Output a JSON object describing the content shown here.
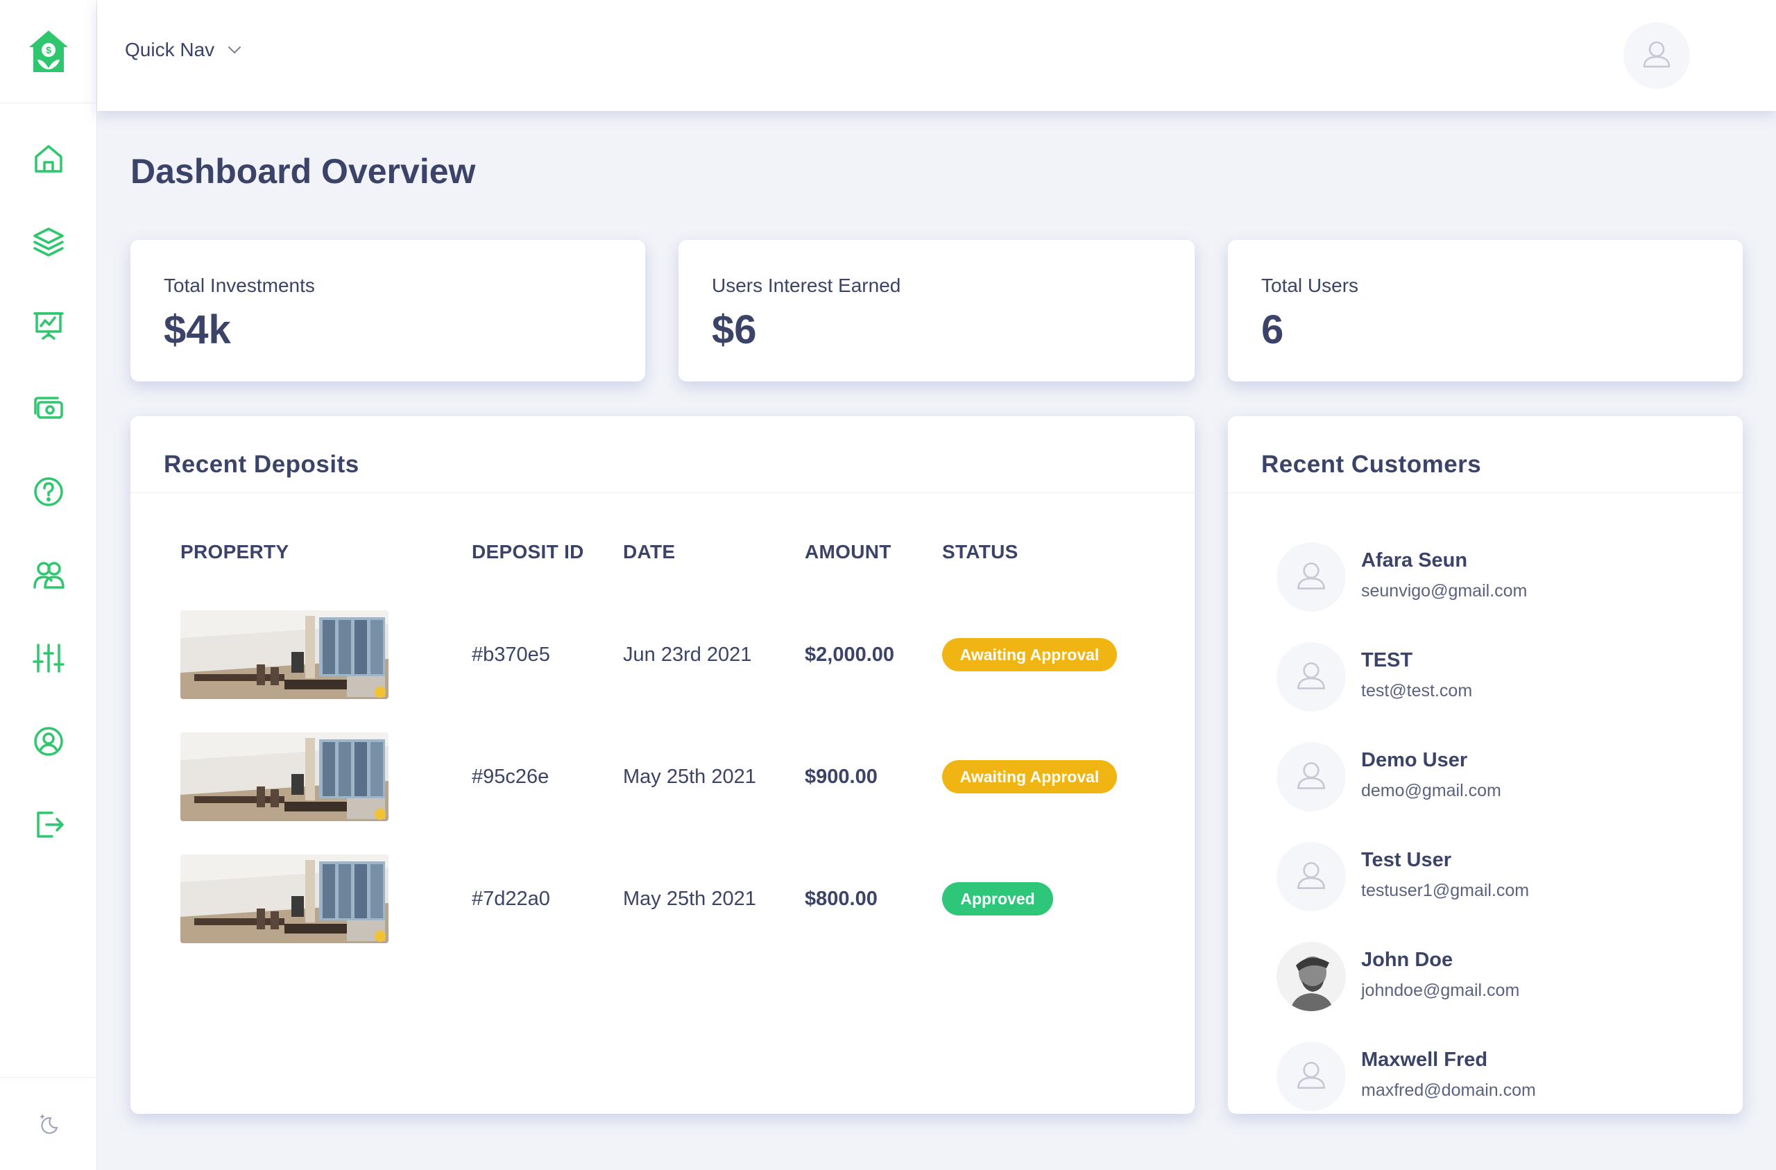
{
  "colors": {
    "accent": "#2ec76e",
    "text": "#3b4468",
    "awaiting": "#f0b413",
    "approved": "#2ec77a",
    "background": "#f1f3f8"
  },
  "sidebar": {
    "logo_icon": "house-money-icon",
    "items": [
      {
        "icon": "home-icon"
      },
      {
        "icon": "layers-icon"
      },
      {
        "icon": "presentation-chart-icon"
      },
      {
        "icon": "cash-icon"
      },
      {
        "icon": "help-circle-icon"
      },
      {
        "icon": "users-icon"
      },
      {
        "icon": "sliders-icon"
      },
      {
        "icon": "user-circle-icon"
      },
      {
        "icon": "logout-icon"
      }
    ],
    "footer_icon": "moon-icon"
  },
  "header": {
    "quick_nav_label": "Quick Nav"
  },
  "page": {
    "title": "Dashboard Overview"
  },
  "stats": [
    {
      "label": "Total Investments",
      "value": "$4k"
    },
    {
      "label": "Users Interest Earned",
      "value": "$6"
    },
    {
      "label": "Total Users",
      "value": "6"
    }
  ],
  "deposits": {
    "title": "Recent Deposits",
    "columns": [
      "PROPERTY",
      "DEPOSIT ID",
      "DATE",
      "AMOUNT",
      "STATUS"
    ],
    "rows": [
      {
        "id": "#b370e5",
        "date": "Jun 23rd 2021",
        "amount": "$2,000.00",
        "status": "Awaiting Approval"
      },
      {
        "id": "#95c26e",
        "date": "May 25th 2021",
        "amount": "$900.00",
        "status": "Awaiting Approval"
      },
      {
        "id": "#7d22a0",
        "date": "May 25th 2021",
        "amount": "$800.00",
        "status": "Approved"
      }
    ]
  },
  "customers": {
    "title": "Recent Customers",
    "items": [
      {
        "name": "Afara Seun",
        "email": "seunvigo@gmail.com"
      },
      {
        "name": "TEST",
        "email": "test@test.com"
      },
      {
        "name": "Demo User",
        "email": "demo@gmail.com"
      },
      {
        "name": "Test User",
        "email": "testuser1@gmail.com"
      },
      {
        "name": "John Doe",
        "email": "johndoe@gmail.com"
      },
      {
        "name": "Maxwell Fred",
        "email": "maxfred@domain.com"
      }
    ]
  }
}
